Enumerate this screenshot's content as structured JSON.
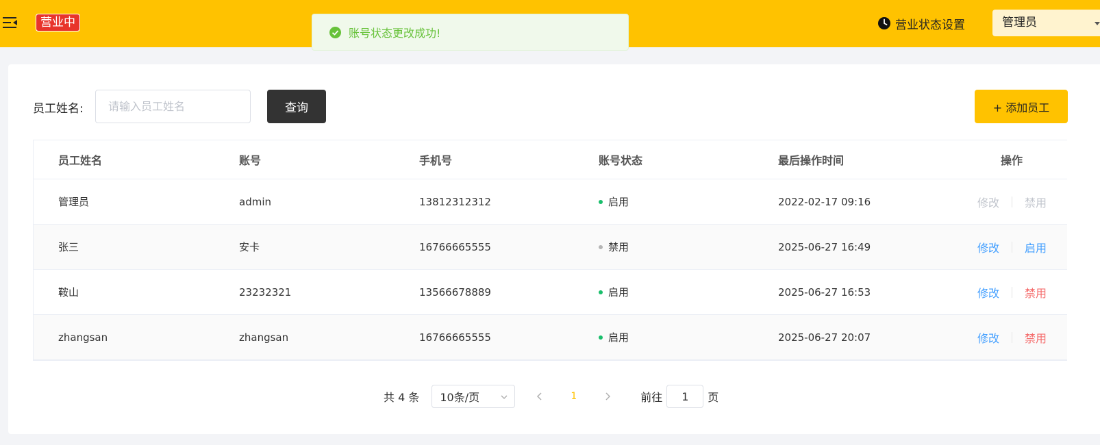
{
  "header": {
    "status_badge": "营业中",
    "status_setting_label": "营业状态设置",
    "user_name": "管理员",
    "brand_color": "#ffc200"
  },
  "toast": {
    "message": "账号状态更改成功!",
    "type": "success"
  },
  "search": {
    "label": "员工姓名:",
    "placeholder": "请输入员工姓名",
    "value": "",
    "query_button": "查询",
    "add_button": "+ 添加员工"
  },
  "table": {
    "headers": [
      "员工姓名",
      "账号",
      "手机号",
      "账号状态",
      "最后操作时间",
      "操作"
    ],
    "rows": [
      {
        "name": "管理员",
        "account": "admin",
        "phone": "13812312312",
        "status": "启用",
        "status_color": "#19be6b",
        "updated": "2022-02-17 09:16",
        "edit": "修改",
        "toggle": "禁用",
        "edit_color": "#c0c4cc",
        "toggle_color": "#c0c4cc"
      },
      {
        "name": "张三",
        "account": "安卡",
        "phone": "16766665555",
        "status": "禁用",
        "status_color": "#b5b5b5",
        "updated": "2025-06-27 16:49",
        "edit": "修改",
        "toggle": "启用",
        "edit_color": "#419eff",
        "toggle_color": "#419eff"
      },
      {
        "name": "鞍山",
        "account": "23232321",
        "phone": "13566678889",
        "status": "启用",
        "status_color": "#19be6b",
        "updated": "2025-06-27 16:53",
        "edit": "修改",
        "toggle": "禁用",
        "edit_color": "#419eff",
        "toggle_color": "#f56c6c"
      },
      {
        "name": "zhangsan",
        "account": "zhangsan",
        "phone": "16766665555",
        "status": "启用",
        "status_color": "#19be6b",
        "updated": "2025-06-27 20:07",
        "edit": "修改",
        "toggle": "禁用",
        "edit_color": "#419eff",
        "toggle_color": "#f56c6c"
      }
    ]
  },
  "pagination": {
    "total_text": "共 4 条",
    "page_size": "10条/页",
    "current_page": "1",
    "jump_label": "前往",
    "jump_value": "1",
    "jump_unit": "页"
  }
}
